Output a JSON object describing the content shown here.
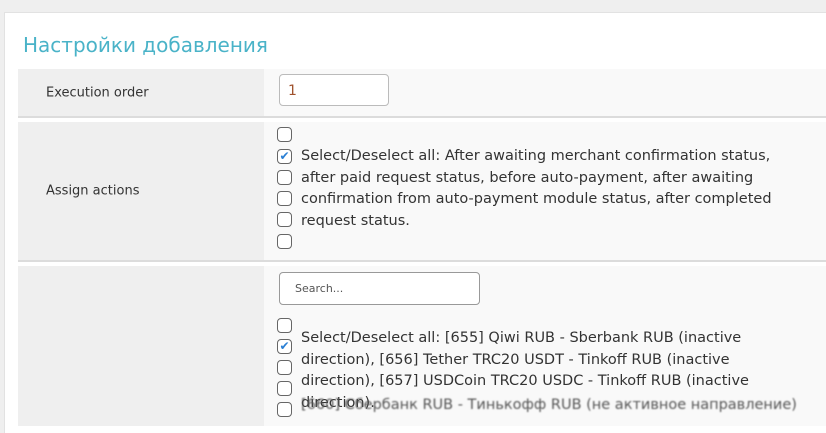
{
  "section_title": "Настройки добавления",
  "execution_order": {
    "label": "Execution order",
    "value": "1"
  },
  "assign_actions": {
    "label": "Assign actions",
    "text": "Select/Deselect all: After awaiting merchant confirmation status, after paid request status, before auto-payment, after awaiting confirmation from auto-payment module status, after completed request status.",
    "checked": [
      false,
      true,
      false,
      false,
      false,
      false
    ]
  },
  "directions": {
    "search_placeholder": "Search...",
    "text": "Select/Deselect all: [655] Qiwi RUB - Sberbank RUB (inactive direction), [656] Tether TRC20 USDT - Tinkoff RUB (inactive direction), [657] USDCoin TRC20 USDC - Tinkoff RUB (inactive direction).",
    "next_item": "[660] Сбербанк RUB - Тинькофф RUB (не активное направление)",
    "checked": [
      false,
      true,
      false,
      false,
      false
    ]
  }
}
